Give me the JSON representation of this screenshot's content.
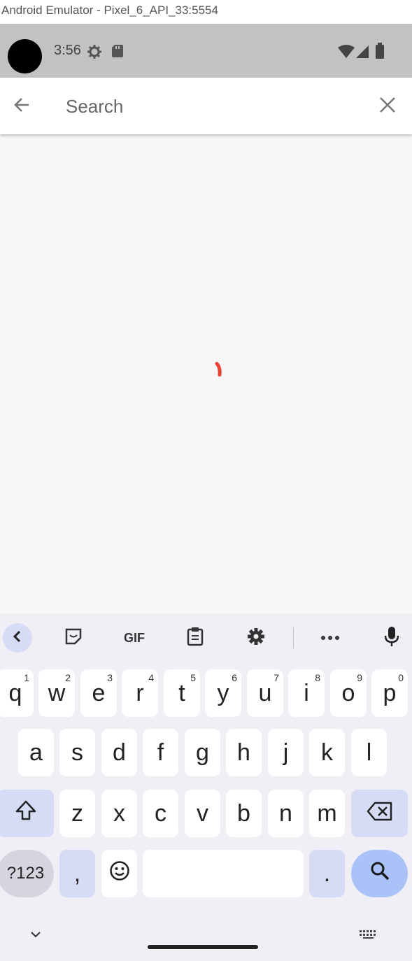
{
  "window": {
    "title": "Android Emulator - Pixel_6_API_33:5554"
  },
  "status_bar": {
    "time": "3:56",
    "icons": [
      "settings-gear-icon",
      "sd-card-icon",
      "wifi-icon",
      "signal-icon",
      "battery-icon"
    ]
  },
  "search": {
    "placeholder": "Search",
    "value": ""
  },
  "content": {
    "loading": true,
    "spinner_color": "#ea4335"
  },
  "keyboard": {
    "toolbar": [
      "back-icon",
      "sticker-icon",
      "GIF",
      "clipboard-icon",
      "settings-icon",
      "more-icon",
      "mic-icon"
    ],
    "gif_label": "GIF",
    "row1": [
      {
        "label": "q",
        "hint": "1"
      },
      {
        "label": "w",
        "hint": "2"
      },
      {
        "label": "e",
        "hint": "3"
      },
      {
        "label": "r",
        "hint": "4"
      },
      {
        "label": "t",
        "hint": "5"
      },
      {
        "label": "y",
        "hint": "6"
      },
      {
        "label": "u",
        "hint": "7"
      },
      {
        "label": "i",
        "hint": "8"
      },
      {
        "label": "o",
        "hint": "9"
      },
      {
        "label": "p",
        "hint": "0"
      }
    ],
    "row2": [
      "a",
      "s",
      "d",
      "f",
      "g",
      "h",
      "j",
      "k",
      "l"
    ],
    "row3": [
      "z",
      "x",
      "c",
      "v",
      "b",
      "n",
      "m"
    ],
    "symbols_label": "?123",
    "comma_label": ",",
    "period_label": ".",
    "space_label": ""
  },
  "colors": {
    "accent": "#a9c2f7",
    "modifier": "#d6dcf6",
    "status_bar": "#c2c2c2"
  }
}
